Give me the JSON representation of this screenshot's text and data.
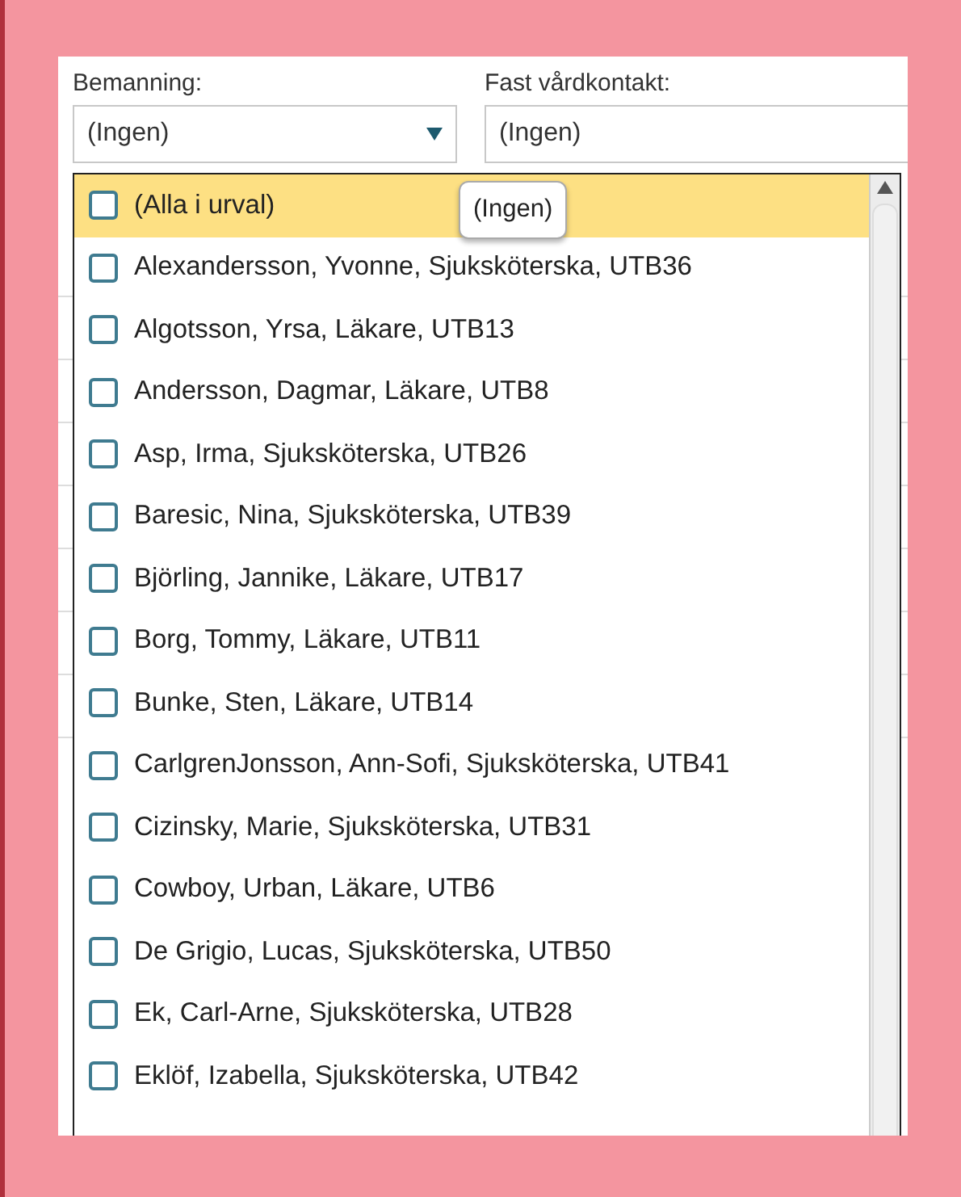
{
  "fields": [
    {
      "label": "Bemanning:",
      "value": "(Ingen)",
      "kind": "dropdown"
    },
    {
      "label": "Fast vårdkontakt:",
      "value": "(Ingen)",
      "kind": "text"
    }
  ],
  "tooltip": "(Ingen)",
  "list": [
    {
      "label": "(Alla i urval)",
      "checked": false,
      "highlighted": true
    },
    {
      "label": "Alexandersson, Yvonne, Sjuksköterska, UTB36",
      "checked": false,
      "highlighted": false
    },
    {
      "label": "Algotsson, Yrsa, Läkare, UTB13",
      "checked": false,
      "highlighted": false
    },
    {
      "label": "Andersson, Dagmar, Läkare, UTB8",
      "checked": false,
      "highlighted": false
    },
    {
      "label": "Asp, Irma, Sjuksköterska, UTB26",
      "checked": false,
      "highlighted": false
    },
    {
      "label": "Baresic, Nina, Sjuksköterska, UTB39",
      "checked": false,
      "highlighted": false
    },
    {
      "label": "Björling, Jannike, Läkare, UTB17",
      "checked": false,
      "highlighted": false
    },
    {
      "label": "Borg, Tommy, Läkare, UTB11",
      "checked": false,
      "highlighted": false
    },
    {
      "label": "Bunke, Sten, Läkare, UTB14",
      "checked": false,
      "highlighted": false
    },
    {
      "label": "CarlgrenJonsson, Ann-Sofi, Sjuksköterska, UTB41",
      "checked": false,
      "highlighted": false
    },
    {
      "label": "Cizinsky, Marie, Sjuksköterska, UTB31",
      "checked": false,
      "highlighted": false
    },
    {
      "label": "Cowboy, Urban, Läkare, UTB6",
      "checked": false,
      "highlighted": false
    },
    {
      "label": "De Grigio, Lucas, Sjuksköterska, UTB50",
      "checked": false,
      "highlighted": false
    },
    {
      "label": "Ek, Carl-Arne, Sjuksköterska, UTB28",
      "checked": false,
      "highlighted": false
    },
    {
      "label": "Eklöf, Izabella, Sjuksköterska, UTB42",
      "checked": false,
      "highlighted": false
    }
  ]
}
